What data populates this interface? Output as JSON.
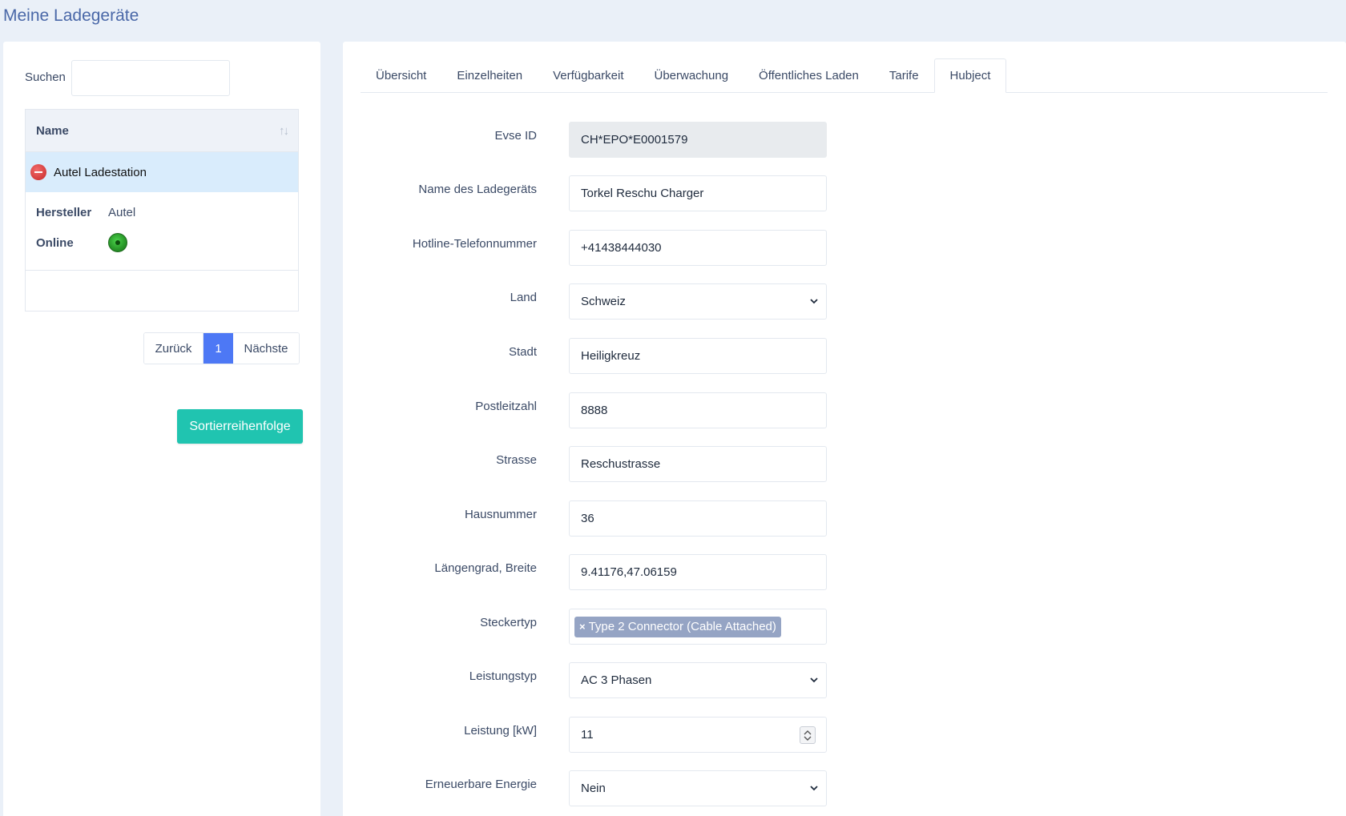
{
  "page": {
    "title": "Meine Ladegeräte"
  },
  "sidebar": {
    "search_label": "Suchen",
    "search_value": "",
    "table": {
      "header": "Name",
      "rows": [
        {
          "name": "Autel Ladestation",
          "status": "error"
        }
      ]
    },
    "details": {
      "manufacturer_label": "Hersteller",
      "manufacturer_value": "Autel",
      "online_label": "Online",
      "online_status": "online"
    },
    "pager": {
      "prev": "Zurück",
      "current": "1",
      "next": "Nächste"
    },
    "sort_button": "Sortierreihenfolge"
  },
  "tabs": [
    {
      "label": "Übersicht",
      "active": false
    },
    {
      "label": "Einzelheiten",
      "active": false
    },
    {
      "label": "Verfügbarkeit",
      "active": false
    },
    {
      "label": "Überwachung",
      "active": false
    },
    {
      "label": "Öffentliches Laden",
      "active": false
    },
    {
      "label": "Tarife",
      "active": false
    },
    {
      "label": "Hubject",
      "active": true
    }
  ],
  "form": {
    "evse_id": {
      "label": "Evse ID",
      "value": "CH*EPO*E0001579"
    },
    "charger_name": {
      "label": "Name des Ladegeräts",
      "value": "Torkel Reschu Charger"
    },
    "hotline": {
      "label": "Hotline-Telefonnummer",
      "value": "+41438444030"
    },
    "country": {
      "label": "Land",
      "value": "Schweiz"
    },
    "city": {
      "label": "Stadt",
      "value": "Heiligkreuz"
    },
    "postal_code": {
      "label": "Postleitzahl",
      "value": "8888"
    },
    "street": {
      "label": "Strasse",
      "value": "Reschustrasse"
    },
    "house_number": {
      "label": "Hausnummer",
      "value": "36"
    },
    "coordinates": {
      "label": "Längengrad, Breite",
      "value": "9.41176,47.06159"
    },
    "plug_type": {
      "label": "Steckertyp",
      "chip": "Type 2 Connector (Cable Attached)",
      "chip_remove": "×"
    },
    "power_type": {
      "label": "Leistungstyp",
      "value": "AC 3 Phasen"
    },
    "power_kw": {
      "label": "Leistung [kW]",
      "value": "11"
    },
    "renewable": {
      "label": "Erneuerbare Energie",
      "value": "Nein"
    }
  },
  "colors": {
    "accent": "#4d78f5",
    "button_teal": "#20c4b0",
    "title_blue": "#4a68a8",
    "selected_row": "#d9ecfc",
    "chip": "#95a4c4"
  }
}
